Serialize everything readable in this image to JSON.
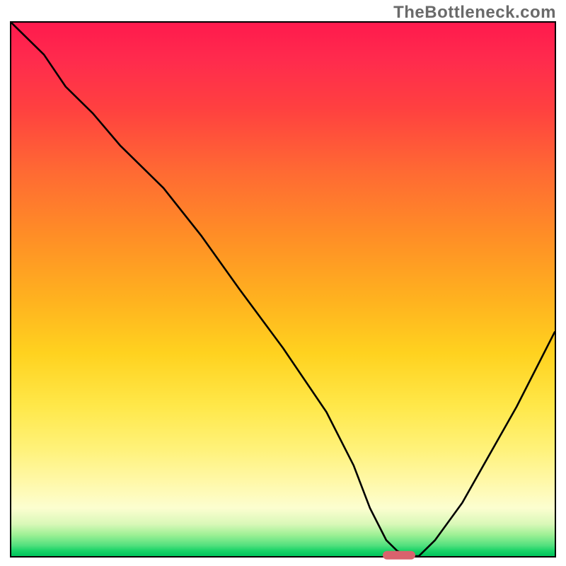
{
  "attribution": "TheBottleneck.com",
  "chart_data": {
    "type": "line",
    "title": "",
    "xlabel": "",
    "ylabel": "",
    "xlim": [
      0,
      100
    ],
    "ylim": [
      0,
      100
    ],
    "series": [
      {
        "name": "bottleneck-curve",
        "x": [
          0,
          6,
          10,
          15,
          20,
          24,
          28,
          35,
          42,
          50,
          58,
          63,
          66,
          69,
          71,
          73,
          75,
          78,
          83,
          88,
          93,
          100
        ],
        "y": [
          100,
          94,
          88,
          83,
          77,
          73,
          69,
          60,
          50,
          39,
          27,
          17,
          9,
          3,
          1,
          0,
          0,
          3,
          10,
          19,
          28,
          42
        ]
      }
    ],
    "min_marker": {
      "x": 74,
      "width_pct": 6
    },
    "background": {
      "type": "vertical-gradient",
      "stops": [
        {
          "pct": 0,
          "color": "#ff1a4d"
        },
        {
          "pct": 50,
          "color": "#ffb21f"
        },
        {
          "pct": 82,
          "color": "#fff27a"
        },
        {
          "pct": 100,
          "color": "#00c45c"
        }
      ]
    }
  }
}
